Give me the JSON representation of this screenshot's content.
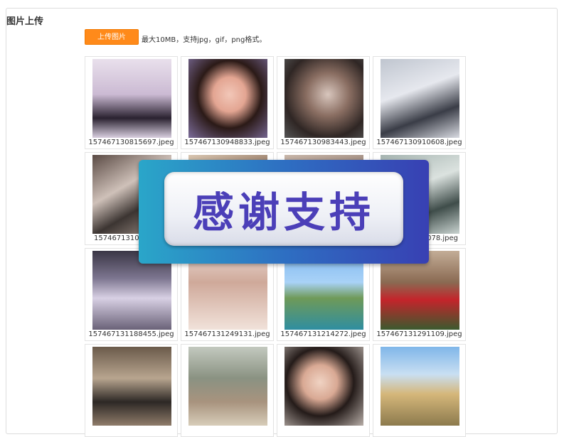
{
  "section": {
    "title": "图片上传"
  },
  "upload": {
    "button_label": "上传图片",
    "hint": "最大10MB，支持jpg，gif，png格式。"
  },
  "images": [
    {
      "filename": "157467130815697.jpeg",
      "icon": "photo"
    },
    {
      "filename": "157467130948833.jpeg",
      "icon": "photo"
    },
    {
      "filename": "157467130983443.jpeg",
      "icon": "photo"
    },
    {
      "filename": "157467130910608.jpeg",
      "icon": "photo"
    },
    {
      "filename": "15746713103",
      "icon": "photo"
    },
    {
      "filename": "",
      "icon": "photo"
    },
    {
      "filename": "",
      "icon": "photo"
    },
    {
      "filename": "078.jpeg",
      "icon": "photo"
    },
    {
      "filename": "157467131188455.jpeg",
      "icon": "photo"
    },
    {
      "filename": "157467131249131.jpeg",
      "icon": "photo"
    },
    {
      "filename": "157467131214272.jpeg",
      "icon": "photo"
    },
    {
      "filename": "157467131291109.jpeg",
      "icon": "photo"
    },
    {
      "filename": "",
      "icon": "photo"
    },
    {
      "filename": "",
      "icon": "photo"
    },
    {
      "filename": "",
      "icon": "photo"
    },
    {
      "filename": "",
      "icon": "photo"
    }
  ],
  "overlay_banner": {
    "text": "感谢支持"
  },
  "colors": {
    "upload_button": "#ff8a1a",
    "banner_gradient_start": "#2aa6c9",
    "banner_gradient_end": "#3840b3",
    "banner_text": "#4b3fb8"
  }
}
